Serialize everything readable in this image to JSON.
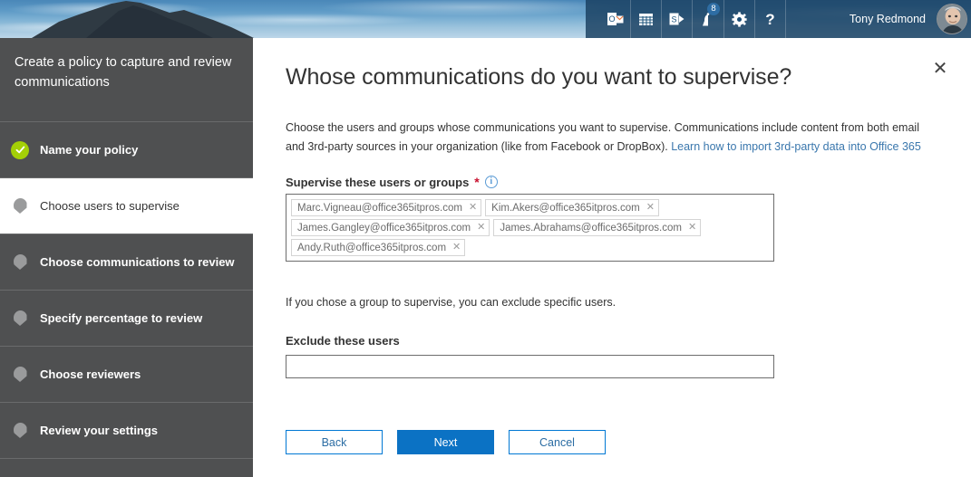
{
  "header": {
    "user_name": "Tony Redmond",
    "notification_count": "8",
    "icons": [
      {
        "name": "outlook-mail-icon",
        "glyph": "O"
      },
      {
        "name": "calendar-icon",
        "glyph": "▦"
      },
      {
        "name": "sharepoint-icon",
        "glyph": "S"
      },
      {
        "name": "notifications-bell-icon",
        "glyph": "🔔"
      },
      {
        "name": "settings-gear-icon",
        "glyph": "⚙"
      },
      {
        "name": "help-question-icon",
        "glyph": "?"
      }
    ]
  },
  "sidebar": {
    "title": "Create a policy to capture and review communications",
    "steps": [
      {
        "label": "Name your policy",
        "state": "done"
      },
      {
        "label": "Choose users to supervise",
        "state": "active"
      },
      {
        "label": "Choose communications to review",
        "state": "pending"
      },
      {
        "label": "Specify percentage to review",
        "state": "pending"
      },
      {
        "label": "Choose reviewers",
        "state": "pending"
      },
      {
        "label": "Review your settings",
        "state": "pending"
      }
    ]
  },
  "main": {
    "heading": "Whose communications do you want to supervise?",
    "intro_text": "Choose the users and groups whose communications you want to supervise. Communications include content from both email and 3rd-party sources in your organization (like from Facebook or DropBox). ",
    "intro_link": "Learn how to import 3rd-party data into Office 365",
    "supervise_label": "Supervise these users or groups",
    "required_mark": "*",
    "info_glyph": "i",
    "close_glyph": "✕",
    "remove_glyph": "✕",
    "tokens": [
      "Marc.Vigneau@office365itpros.com",
      "Kim.Akers@office365itpros.com",
      "James.Gangley@office365itpros.com",
      "James.Abrahams@office365itpros.com",
      "Andy.Ruth@office365itpros.com"
    ],
    "hint_text": "If you chose a group to supervise, you can exclude specific users.",
    "exclude_label": "Exclude these users",
    "exclude_value": "",
    "exclude_placeholder": "",
    "buttons": {
      "back": "Back",
      "next": "Next",
      "cancel": "Cancel"
    }
  },
  "colors": {
    "accent": "#0b72c4",
    "link": "#3a77ad",
    "required": "#c8102e",
    "rail": "#4f5051",
    "done": "#a4d007"
  }
}
